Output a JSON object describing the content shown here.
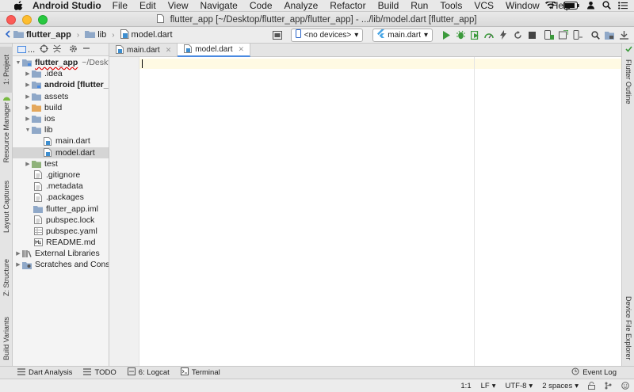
{
  "menubar": {
    "app_name": "Android Studio",
    "items": [
      "File",
      "Edit",
      "View",
      "Navigate",
      "Code",
      "Analyze",
      "Refactor",
      "Build",
      "Run",
      "Tools",
      "VCS",
      "Window",
      "Help"
    ]
  },
  "window": {
    "title": "flutter_app [~/Desktop/flutter_app/flutter_app] - .../lib/model.dart [flutter_app]"
  },
  "navbar": {
    "breadcrumbs": [
      "flutter_app",
      "lib",
      "model.dart"
    ],
    "device_selector": "<no devices>",
    "run_config": "main.dart"
  },
  "left_stripe": {
    "tabs": [
      "1: Project",
      "Resource Manager",
      "Layout Captures",
      "Z: Structure",
      "Build Variants"
    ]
  },
  "right_stripe": {
    "tabs": [
      "Flutter Outline",
      "Device File Explorer"
    ]
  },
  "project": {
    "toolbar_label": "...",
    "root": {
      "label": "flutter_app",
      "path": "~/Deskt"
    },
    "tree": [
      {
        "label": "idea",
        "prefix": ".",
        "extra": ""
      },
      {
        "label": "android",
        "prefix": "",
        "extra": "[flutter_a"
      },
      {
        "label": "assets",
        "prefix": "",
        "extra": ""
      },
      {
        "label": "build",
        "prefix": "",
        "extra": ""
      },
      {
        "label": "ios",
        "prefix": "",
        "extra": ""
      },
      {
        "label": "lib",
        "prefix": "",
        "extra": ""
      },
      {
        "label": "main.dart",
        "prefix": "",
        "extra": ""
      },
      {
        "label": "model.dart",
        "prefix": "",
        "extra": ""
      },
      {
        "label": "test",
        "prefix": "",
        "extra": ""
      },
      {
        "label": ".gitignore",
        "prefix": "",
        "extra": ""
      },
      {
        "label": ".metadata",
        "prefix": "",
        "extra": ""
      },
      {
        "label": ".packages",
        "prefix": "",
        "extra": ""
      },
      {
        "label": "flutter_app.iml",
        "prefix": "",
        "extra": ""
      },
      {
        "label": "pubspec.lock",
        "prefix": "",
        "extra": ""
      },
      {
        "label": "pubspec.yaml",
        "prefix": "",
        "extra": ""
      },
      {
        "label": "README.md",
        "prefix": "",
        "extra": ""
      },
      {
        "label": "External Libraries",
        "prefix": "",
        "extra": ""
      },
      {
        "label": "Scratches and Cons",
        "prefix": "",
        "extra": ""
      }
    ]
  },
  "editor": {
    "tabs": [
      {
        "label": "main.dart",
        "active": false
      },
      {
        "label": "model.dart",
        "active": true
      }
    ]
  },
  "tool_windows": {
    "dart_analysis": "Dart Analysis",
    "todo": "TODO",
    "logcat": "6: Logcat",
    "terminal": "Terminal",
    "event_log": "Event Log"
  },
  "status": {
    "position": "1:1",
    "line_sep": "LF",
    "encoding": "UTF-8",
    "indent": "2 spaces"
  },
  "colors": {
    "accent": "#4a8ae0",
    "run_green": "#3c9a3c",
    "folder": "#8fa8c8",
    "selected_row": "#d5d5d5",
    "current_line": "#fffae3"
  }
}
